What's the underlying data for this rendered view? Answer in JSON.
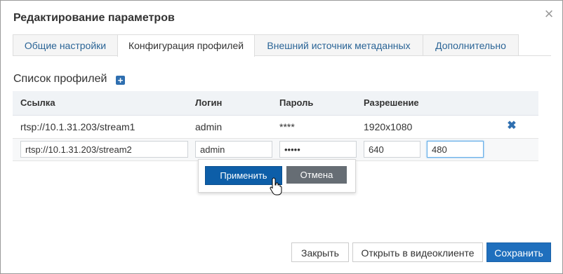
{
  "dialog": {
    "title": "Редактирование параметров"
  },
  "tabs": [
    {
      "label": "Общие настройки",
      "active": false
    },
    {
      "label": "Конфигурация профилей",
      "active": true
    },
    {
      "label": "Внешний источник метаданных",
      "active": false
    },
    {
      "label": "Дополнительно",
      "active": false
    }
  ],
  "profiles": {
    "section_title": "Список профилей",
    "headers": {
      "url": "Ссылка",
      "login": "Логин",
      "password": "Пароль",
      "resolution": "Разрешение"
    },
    "rows": [
      {
        "url": "rtsp://10.1.31.203/stream1",
        "login": "admin",
        "password": "****",
        "resolution": "1920x1080"
      }
    ],
    "edit_row": {
      "url": "rtsp://10.1.31.203/stream2",
      "login": "admin",
      "password": "•••••",
      "width": "640",
      "height": "480"
    }
  },
  "popover": {
    "apply_label": "Применить",
    "cancel_label": "Отмена"
  },
  "footer": {
    "close_label": "Закрыть",
    "open_client_label": "Открыть в видеоклиенте",
    "save_label": "Сохранить"
  },
  "colors": {
    "accent": "#1f6fbd",
    "link": "#2a6496"
  }
}
